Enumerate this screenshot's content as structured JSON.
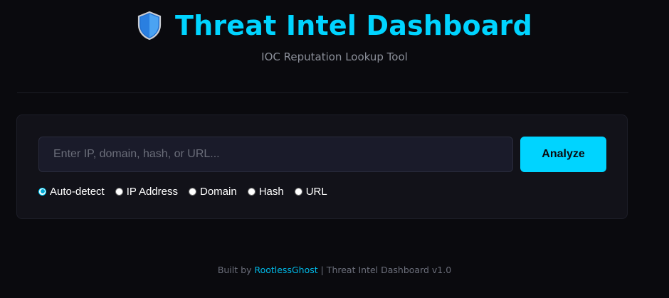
{
  "header": {
    "title": "Threat Intel Dashboard",
    "subtitle": "IOC Reputation Lookup Tool",
    "icon": "shield-icon"
  },
  "search": {
    "placeholder": "Enter IP, domain, hash, or URL...",
    "value": "",
    "button_label": "Analyze"
  },
  "types": {
    "selected": "Auto-detect",
    "options": [
      {
        "label": "Auto-detect",
        "checked": true
      },
      {
        "label": "IP Address",
        "checked": false
      },
      {
        "label": "Domain",
        "checked": false
      },
      {
        "label": "Hash",
        "checked": false
      },
      {
        "label": "URL",
        "checked": false
      }
    ]
  },
  "footer": {
    "prefix": "Built by",
    "author": "RootlessGhost",
    "suffix": "| Threat Intel Dashboard v1.0"
  },
  "colors": {
    "background": "#0a0a0e",
    "accent": "#00d4ff",
    "card": "#121219",
    "input": "#1a1b2a",
    "muted_text": "#8b8f99"
  }
}
